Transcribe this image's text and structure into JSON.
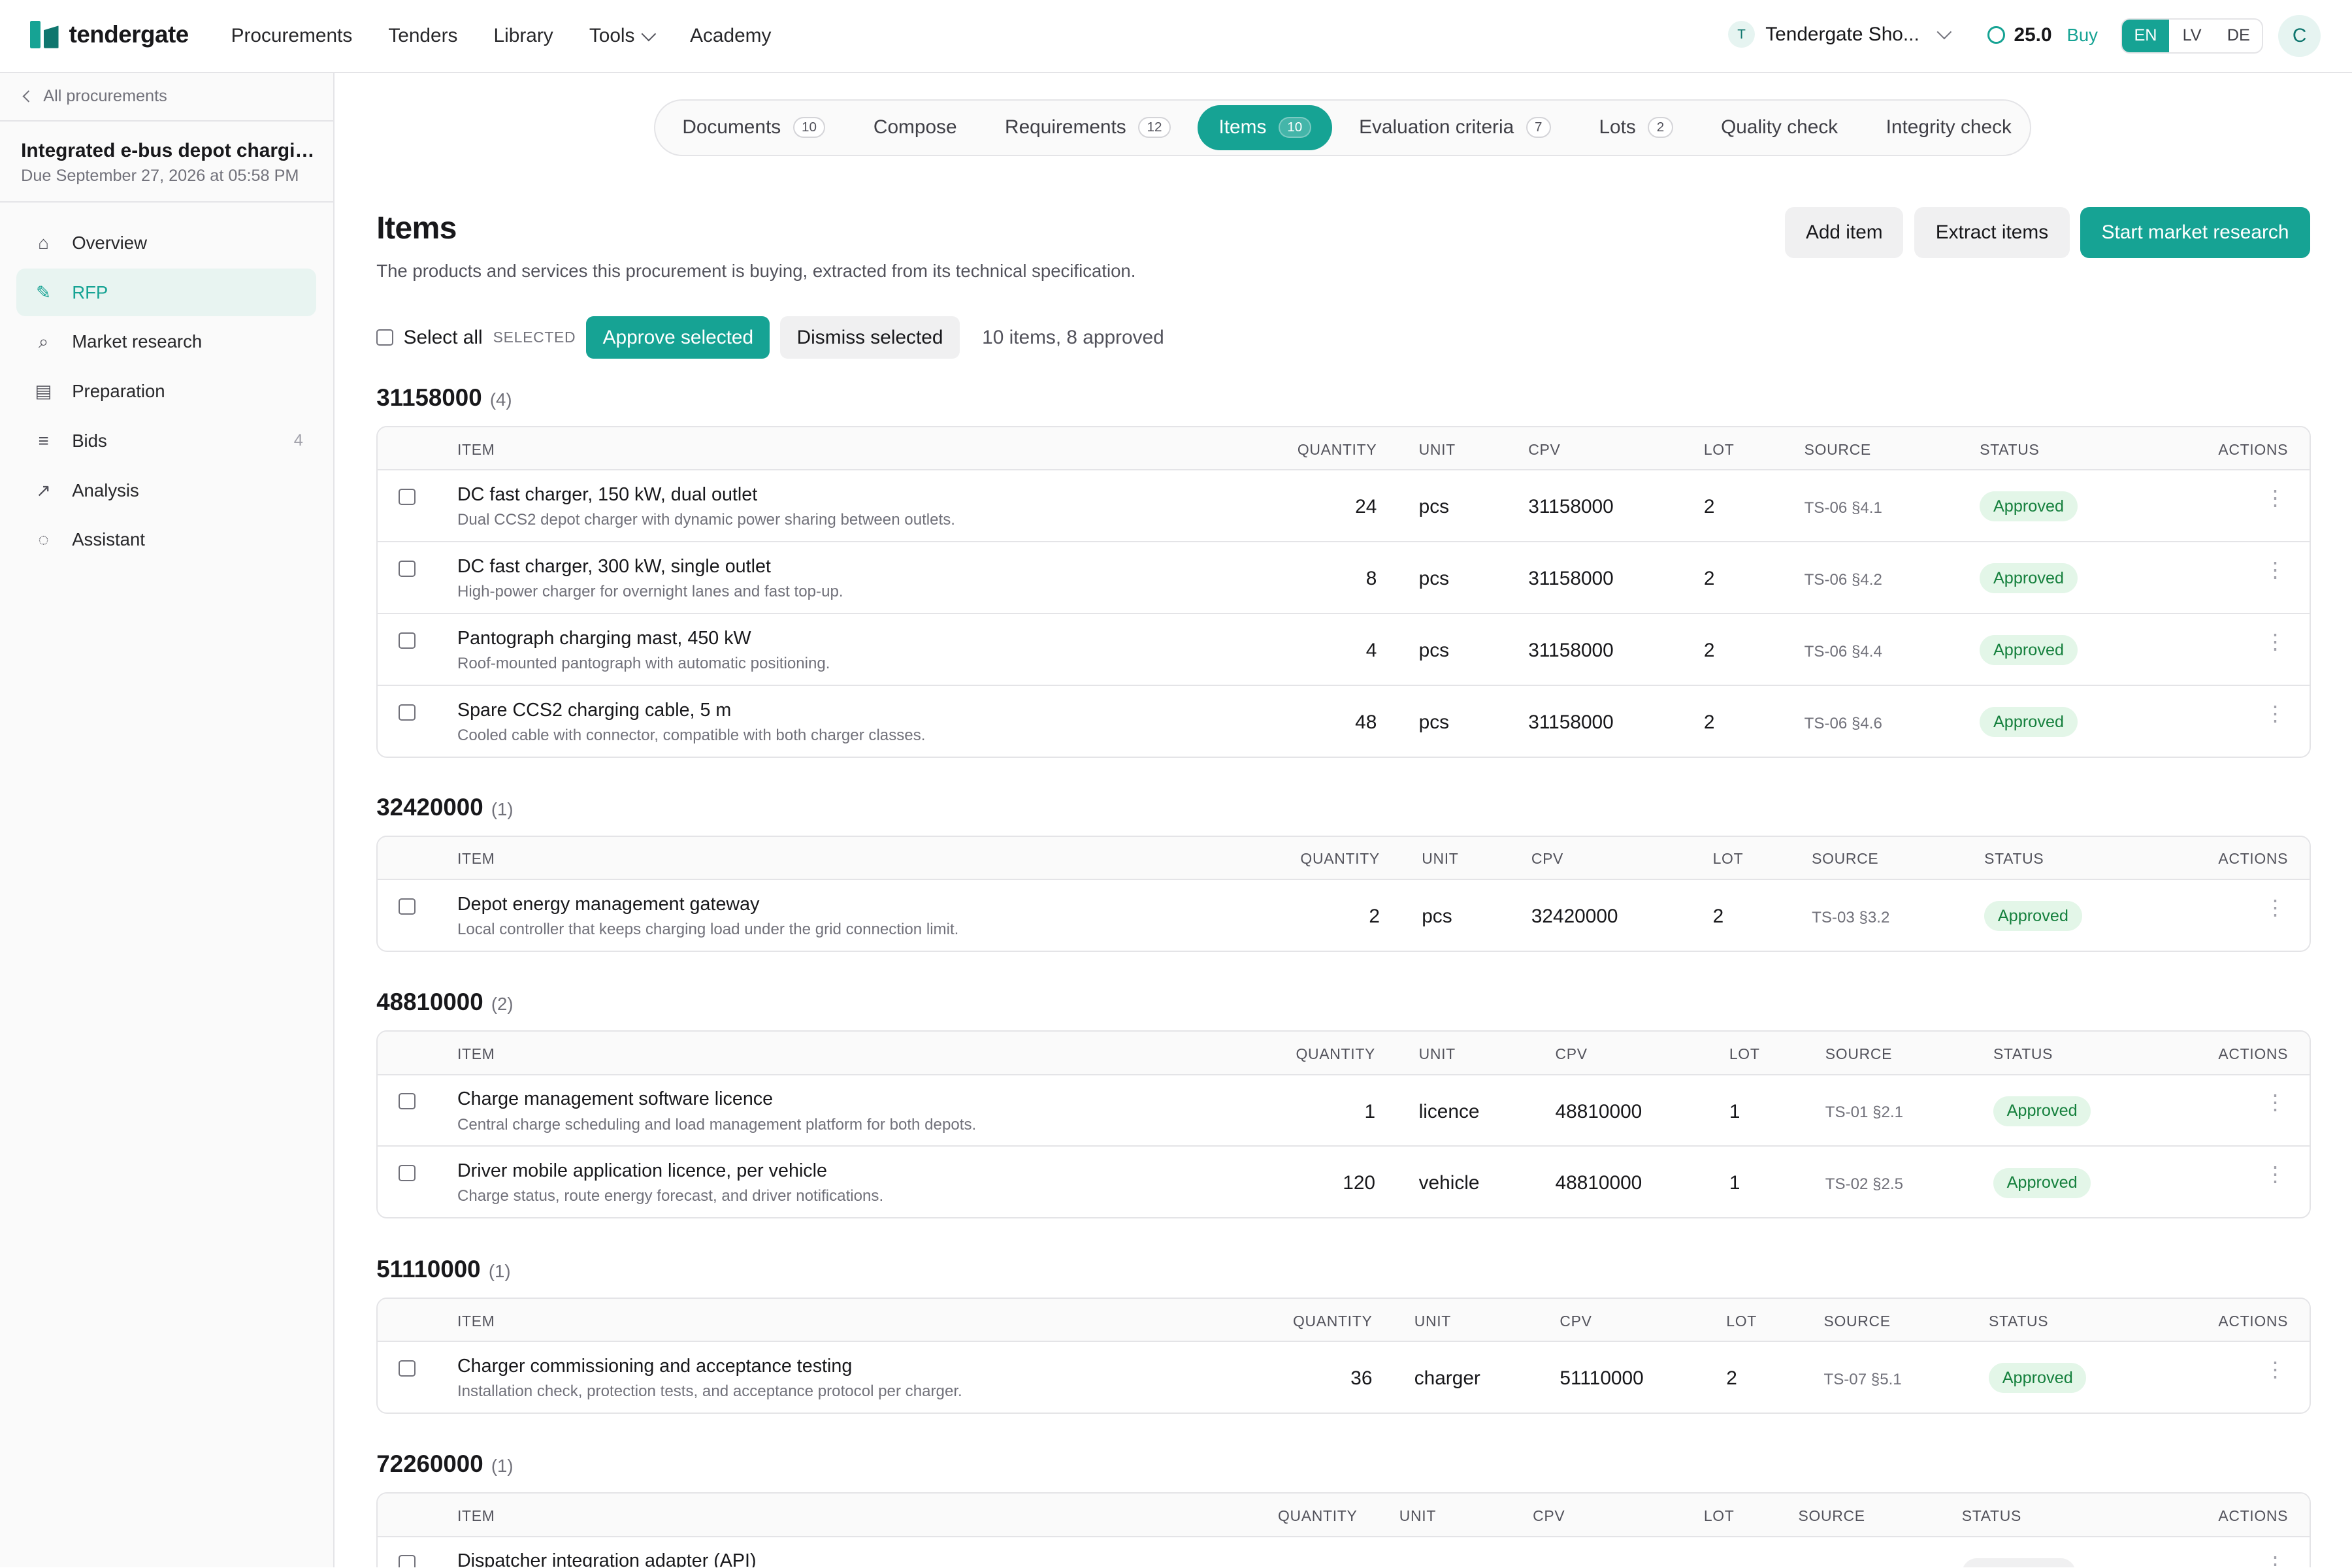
{
  "app": {
    "brand": "tendergate",
    "nav": [
      "Procurements",
      "Tenders",
      "Library",
      "Tools",
      "Academy"
    ],
    "org_initial": "T",
    "org_name": "Tendergate Sho...",
    "credits": "25.0",
    "buy_label": "Buy",
    "languages": [
      "EN",
      "LV",
      "DE"
    ],
    "active_language": "EN",
    "user_initial": "C"
  },
  "sidebar": {
    "back_label": "All procurements",
    "project_title": "Integrated e-bus depot charging infrastructure",
    "project_due": "Due September 27, 2026 at 05:58 PM",
    "items": [
      {
        "label": "Overview",
        "icon": "home-icon",
        "glyph": "⌂"
      },
      {
        "label": "RFP",
        "icon": "document-pen-icon",
        "glyph": "✎"
      },
      {
        "label": "Market research",
        "icon": "search-icon",
        "glyph": "⌕"
      },
      {
        "label": "Preparation",
        "icon": "clipboard-icon",
        "glyph": "▤"
      },
      {
        "label": "Bids",
        "icon": "list-icon",
        "glyph": "≡",
        "count": "4"
      },
      {
        "label": "Analysis",
        "icon": "trend-icon",
        "glyph": "↗"
      },
      {
        "label": "Assistant",
        "icon": "chat-icon",
        "glyph": "◌"
      }
    ],
    "active": "RFP"
  },
  "tabs": [
    {
      "label": "Documents",
      "count": "10"
    },
    {
      "label": "Compose"
    },
    {
      "label": "Requirements",
      "count": "12"
    },
    {
      "label": "Items",
      "count": "10",
      "active": true
    },
    {
      "label": "Evaluation criteria",
      "count": "7"
    },
    {
      "label": "Lots",
      "count": "2"
    },
    {
      "label": "Quality check"
    },
    {
      "label": "Integrity check"
    }
  ],
  "page": {
    "title": "Items",
    "subtitle": "The products and services this procurement is buying, extracted from its technical specification.",
    "add_item": "Add item",
    "extract_items": "Extract items",
    "start_research": "Start market research"
  },
  "bulk": {
    "select_all": "Select all",
    "selected_label": "SELECTED",
    "approve_selected": "Approve selected",
    "dismiss_selected": "Dismiss selected",
    "summary": "10 items, 8 approved"
  },
  "columns": [
    "ITEM",
    "QUANTITY",
    "UNIT",
    "CPV",
    "LOT",
    "SOURCE",
    "STATUS",
    "ACTIONS"
  ],
  "groups": [
    {
      "code": "31158000",
      "count": "(4)",
      "rows": [
        {
          "name": "DC fast charger, 150 kW, dual outlet",
          "desc": "Dual CCS2 depot charger with dynamic power sharing between outlets.",
          "qty": "24",
          "unit": "pcs",
          "cpv": "31158000",
          "lot": "2",
          "source": "TS-06 §4.1",
          "status": "Approved"
        },
        {
          "name": "DC fast charger, 300 kW, single outlet",
          "desc": "High-power charger for overnight lanes and fast top-up.",
          "qty": "8",
          "unit": "pcs",
          "cpv": "31158000",
          "lot": "2",
          "source": "TS-06 §4.2",
          "status": "Approved"
        },
        {
          "name": "Pantograph charging mast, 450 kW",
          "desc": "Roof-mounted pantograph with automatic positioning.",
          "qty": "4",
          "unit": "pcs",
          "cpv": "31158000",
          "lot": "2",
          "source": "TS-06 §4.4",
          "status": "Approved"
        },
        {
          "name": "Spare CCS2 charging cable, 5 m",
          "desc": "Cooled cable with connector, compatible with both charger classes.",
          "qty": "48",
          "unit": "pcs",
          "cpv": "31158000",
          "lot": "2",
          "source": "TS-06 §4.6",
          "status": "Approved"
        }
      ]
    },
    {
      "code": "32420000",
      "count": "(1)",
      "rows": [
        {
          "name": "Depot energy management gateway",
          "desc": "Local controller that keeps charging load under the grid connection limit.",
          "qty": "2",
          "unit": "pcs",
          "cpv": "32420000",
          "lot": "2",
          "source": "TS-03 §3.2",
          "status": "Approved"
        }
      ]
    },
    {
      "code": "48810000",
      "count": "(2)",
      "rows": [
        {
          "name": "Charge management software licence",
          "desc": "Central charge scheduling and load management platform for both depots.",
          "qty": "1",
          "unit": "licence",
          "cpv": "48810000",
          "lot": "1",
          "source": "TS-01 §2.1",
          "status": "Approved"
        },
        {
          "name": "Driver mobile application licence, per vehicle",
          "desc": "Charge status, route energy forecast, and driver notifications.",
          "qty": "120",
          "unit": "vehicle",
          "cpv": "48810000",
          "lot": "1",
          "source": "TS-02 §2.5",
          "status": "Approved"
        }
      ]
    },
    {
      "code": "51110000",
      "count": "(1)",
      "rows": [
        {
          "name": "Charger commissioning and acceptance testing",
          "desc": "Installation check, protection tests, and acceptance protocol per charger.",
          "qty": "36",
          "unit": "charger",
          "cpv": "51110000",
          "lot": "2",
          "source": "TS-07 §5.1",
          "status": "Approved"
        }
      ]
    },
    {
      "code": "72260000",
      "count": "(1)",
      "rows": [
        {
          "name": "Dispatcher integration adapter (API)",
          "desc": "",
          "qty": "",
          "unit": "",
          "cpv": "",
          "lot": "",
          "source": "",
          "status": ""
        }
      ]
    }
  ]
}
